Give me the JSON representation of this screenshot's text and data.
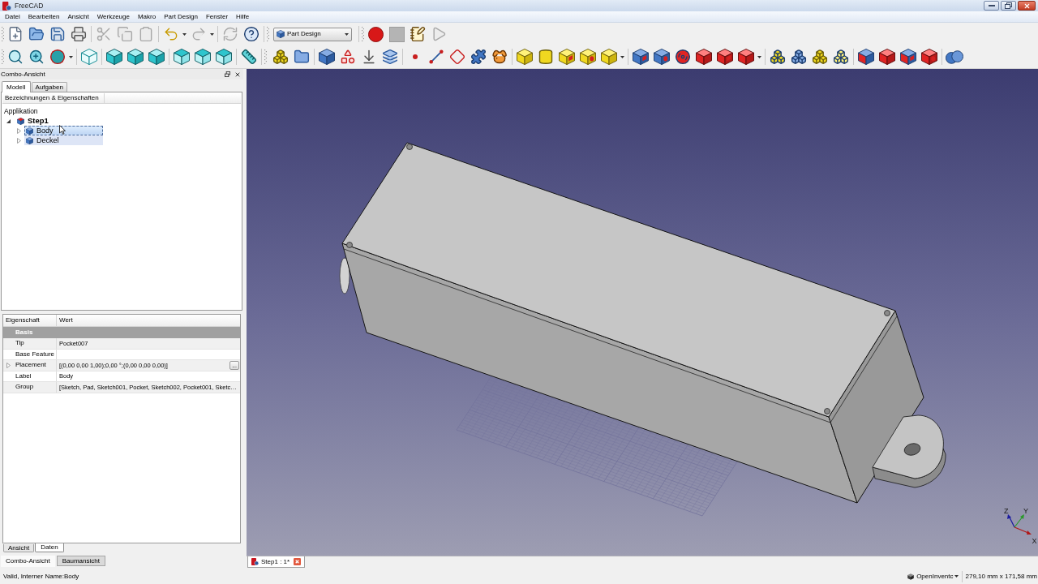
{
  "window": {
    "title": "FreeCAD"
  },
  "menu": [
    "Datei",
    "Bearbeiten",
    "Ansicht",
    "Werkzeuge",
    "Makro",
    "Part Design",
    "Fenster",
    "Hilfe"
  ],
  "toolbar": {
    "buttons": [
      {
        "disabled": false
      },
      {
        "disabled": false
      },
      {
        "disabled": false
      },
      {
        "disabled": false
      },
      {
        "disabled": true
      },
      {
        "disabled": true
      },
      {
        "disabled": true
      },
      {
        "disabled": false
      },
      {
        "disabled": true
      },
      {
        "disabled": true
      },
      {
        "disabled": false
      },
      {
        "disabled": false
      },
      {
        "disabled": true
      },
      {
        "disabled": false
      },
      {
        "disabled": true
      }
    ],
    "workbench": "Part Design"
  },
  "combo_view": {
    "title": "Combo-Ansicht",
    "tabs": [
      {
        "label": "Modell",
        "selected": true
      },
      {
        "label": "Aufgaben",
        "selected": false
      }
    ],
    "tree": {
      "header": "Bezeichnungen & Eigenschaften",
      "root": "Applikation",
      "items": [
        {
          "label": "Step1",
          "expanded": true,
          "selected": false,
          "focused": false,
          "children": [
            {
              "label": "Body",
              "expanded": false,
              "selected": true,
              "focused": true
            },
            {
              "label": "Deckel",
              "expanded": false,
              "selected": true,
              "focused": false
            }
          ]
        }
      ]
    }
  },
  "properties": {
    "columns": [
      "Eigenschaft",
      "Wert"
    ],
    "groups": [
      {
        "label": "Basis",
        "rows": [
          {
            "name": "Tip",
            "value": "Pocket007",
            "expandable": false
          },
          {
            "name": "Base Feature",
            "expandable": false
          },
          {
            "name": "Placement",
            "value": "[(0,00 0,00 1,00);0,00 °;(0,00 0,00 0,00)]",
            "expandable": true,
            "button": "..."
          },
          {
            "name": "Label",
            "value": "Body",
            "expandable": false
          },
          {
            "name": "Group",
            "value": "[Sketch, Pad, Sketch001, Pocket, Sketch002, Pocket001, Sketc…",
            "expandable": false
          }
        ]
      }
    ],
    "tabs": [
      {
        "label": "Ansicht",
        "selected": false
      },
      {
        "label": "Daten",
        "selected": true
      }
    ]
  },
  "panel_tabs": [
    {
      "label": "Combo-Ansicht",
      "selected": true
    },
    {
      "label": "Baumansicht",
      "selected": false
    }
  ],
  "document_tabs": [
    {
      "label": "Step1 : 1*",
      "selected": true
    }
  ],
  "viewport": {
    "axes": [
      "Z",
      "Y",
      "X"
    ]
  },
  "status_bar": {
    "message": "Valid, Interner Name:Body",
    "renderer": "OpenInventc",
    "size": "279,10 mm x 171,58 mm"
  }
}
